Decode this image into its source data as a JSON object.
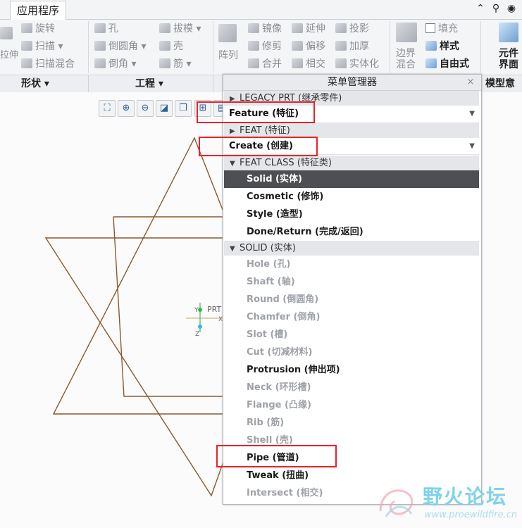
{
  "tabs": {
    "app": "应用程序"
  },
  "ribbon": {
    "shape": {
      "extrude": "拉伸",
      "revolve": "旋转",
      "sweep": "扫描",
      "swept_blend": "扫描混合"
    },
    "engineering": {
      "hole": "孔",
      "round": "倒圆角",
      "chamfer": "倒角",
      "draft": "拔模",
      "shell": "壳",
      "rib": "筋"
    },
    "editing": {
      "pattern": "阵列",
      "mirror": "镜像",
      "trim": "修剪",
      "merge": "合并",
      "extend": "延伸",
      "offset": "偏移",
      "intersect": "相交",
      "project": "投影",
      "thicken": "加厚",
      "solidify": "实体化"
    },
    "surfaces": {
      "boundary_blend": "边界\n混合",
      "fill": "填充",
      "style": "样式",
      "freestyle": "自由式"
    },
    "component": {
      "interface": "元件\n界面"
    }
  },
  "groups": {
    "shape": "形状",
    "engineering": "工程",
    "model_intent": "模型意"
  },
  "csys_label": "PRT",
  "menu_manager": {
    "title": "菜单管理器",
    "close": "×",
    "sections": [
      {
        "header": "LEGACY PRT (继承零件)",
        "collapsed": true,
        "selected": "Feature (特征)"
      },
      {
        "header": "FEAT (特征)",
        "collapsed": true,
        "selected": "Create (创建)"
      },
      {
        "header": "FEAT CLASS (特征类)",
        "collapsed": false,
        "items": [
          {
            "label": "Solid (实体)",
            "state": "active"
          },
          {
            "label": "Cosmetic (修饰)",
            "state": "enabled"
          },
          {
            "label": "Style (造型)",
            "state": "enabled"
          },
          {
            "label": "Done/Return (完成/返回)",
            "state": "enabled"
          }
        ]
      },
      {
        "header": "SOLID (实体)",
        "collapsed": false,
        "items": [
          {
            "label": "Hole (孔)",
            "state": "disabled"
          },
          {
            "label": "Shaft (轴)",
            "state": "disabled"
          },
          {
            "label": "Round (倒圆角)",
            "state": "disabled"
          },
          {
            "label": "Chamfer (倒角)",
            "state": "disabled"
          },
          {
            "label": "Slot (槽)",
            "state": "disabled"
          },
          {
            "label": "Cut (切减材料)",
            "state": "disabled"
          },
          {
            "label": "Protrusion (伸出项)",
            "state": "enabled"
          },
          {
            "label": "Neck (环形槽)",
            "state": "disabled"
          },
          {
            "label": "Flange (凸缘)",
            "state": "disabled"
          },
          {
            "label": "Rib (筋)",
            "state": "disabled"
          },
          {
            "label": "Shell (壳)",
            "state": "disabled"
          },
          {
            "label": "Pipe (管道)",
            "state": "enabled"
          },
          {
            "label": "Tweak (扭曲)",
            "state": "enabled"
          },
          {
            "label": "Intersect (相交)",
            "state": "disabled"
          }
        ]
      }
    ]
  },
  "watermark": {
    "name": "野火论坛",
    "url": "www.proewildfire.cn"
  },
  "colors": {
    "annotation": "#e8232a",
    "sketch_line": "#8b5a2b",
    "active_item": "#4d4f53"
  }
}
